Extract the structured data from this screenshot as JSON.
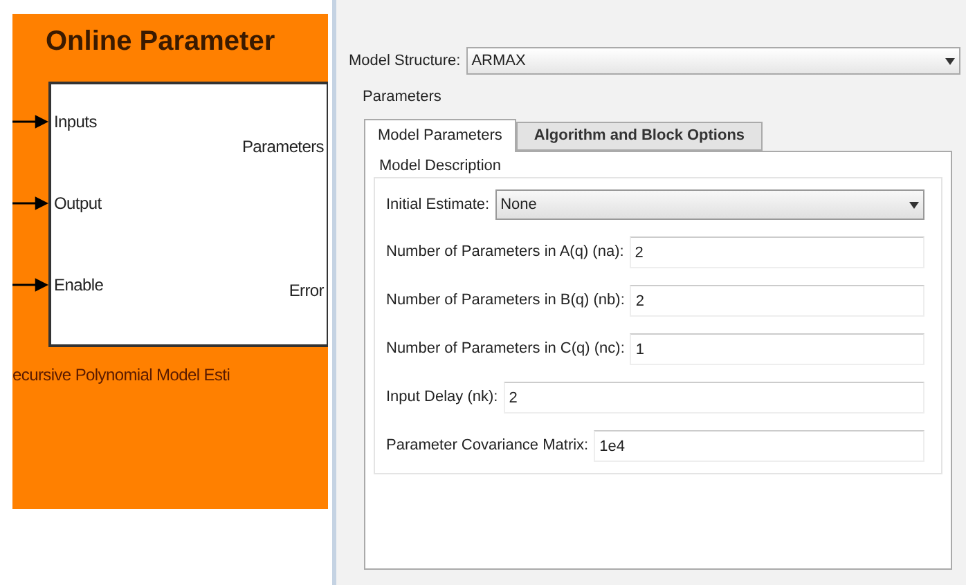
{
  "block": {
    "title": "Online Parameter",
    "inputs": [
      "Inputs",
      "Output",
      "Enable"
    ],
    "outputs": [
      "Parameters",
      "Error"
    ],
    "caption": "ecursive Polynomial Model Esti"
  },
  "dialog": {
    "model_structure": {
      "label": "Model Structure:",
      "value": "ARMAX"
    },
    "section": "Parameters",
    "tabs": [
      {
        "label": "Model Parameters",
        "selected": true
      },
      {
        "label": "Algorithm and Block Options",
        "selected": false
      }
    ],
    "group": "Model Description",
    "initial_estimate": {
      "label": "Initial Estimate:",
      "value": "None"
    },
    "fields": [
      {
        "label": "Number of Parameters in A(q) (na):",
        "value": "2"
      },
      {
        "label": "Number of Parameters in B(q) (nb):",
        "value": "2"
      },
      {
        "label": "Number of Parameters in C(q) (nc):",
        "value": "1"
      },
      {
        "label": "Input Delay (nk):",
        "value": "2"
      },
      {
        "label": "Parameter Covariance Matrix:",
        "value": "1e4"
      }
    ]
  }
}
